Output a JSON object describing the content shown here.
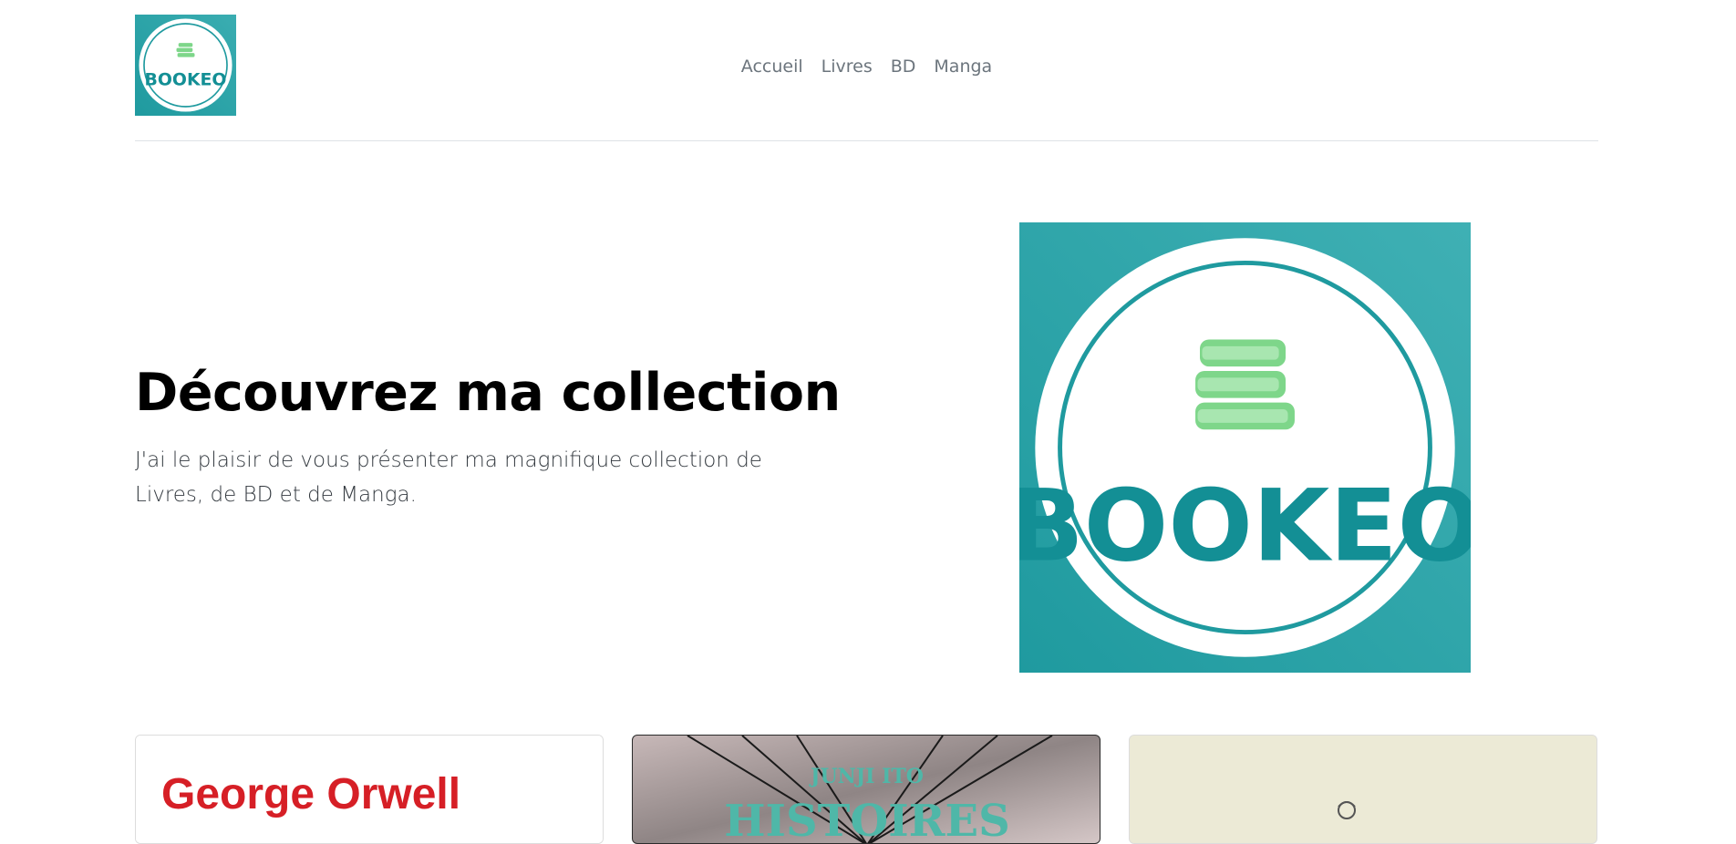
{
  "brand": {
    "name": "BOOKEO",
    "teal": "#27a3a8",
    "green": "#7ed68a"
  },
  "nav": [
    {
      "label": "Accueil"
    },
    {
      "label": "Livres"
    },
    {
      "label": "BD"
    },
    {
      "label": "Manga"
    }
  ],
  "hero": {
    "title": "Découvrez ma collection",
    "text": "J'ai le plaisir de vous présenter ma magnifique collection de Livres, de BD et de Manga."
  },
  "cards": [
    {
      "title": "George Orwell"
    },
    {
      "title": "HISTOIRES",
      "author": "JUNJI ITO"
    },
    {
      "title": ""
    }
  ]
}
